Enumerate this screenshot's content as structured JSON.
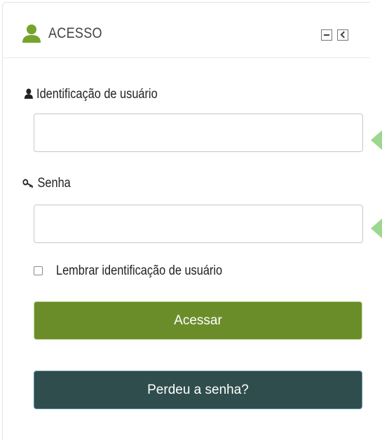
{
  "block": {
    "title": "ACESSO",
    "header_icon": "user-icon",
    "controls": [
      {
        "name": "minimize-icon"
      },
      {
        "name": "dock-icon"
      }
    ]
  },
  "form": {
    "username": {
      "label": "Identificação de usuário",
      "icon": "user-icon",
      "value": "",
      "placeholder": ""
    },
    "password": {
      "label": "Senha",
      "icon": "key-icon",
      "value": "",
      "placeholder": ""
    },
    "remember_label": "Lembrar identificação de usuário",
    "remember_checked": false,
    "login_button": "Acessar",
    "forgot_button": "Perdeu a senha?"
  },
  "colors": {
    "brand_green": "#6a8d2a",
    "dark_teal": "#2f4d4c",
    "header_icon_green": "#76a32c",
    "pointer_green": "#9bd88e"
  }
}
